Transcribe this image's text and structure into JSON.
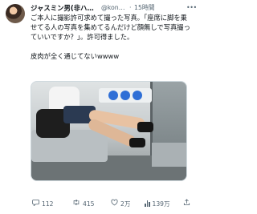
{
  "tweet": {
    "display_name": "ジャスミン男(非ハ…",
    "handle": "@konm…",
    "separator": "·",
    "time": "15時間",
    "text": "ご本人に撮影許可求めて撮った写真。「座席に脚を乗せてる人の写真を集めてるんだけど顔無しで写真撮っていいですか？」。許可得ました。\n\n皮肉が全く通じてないwwww",
    "more_icon": "more-icon"
  },
  "actions": {
    "reply_count": "112",
    "retweet_count": "415",
    "like_count": "2万",
    "views_count": "139万",
    "reply_icon": "reply-icon",
    "retweet_icon": "retweet-icon",
    "like_icon": "heart-icon",
    "views_icon": "views-icon",
    "share_icon": "share-icon"
  }
}
